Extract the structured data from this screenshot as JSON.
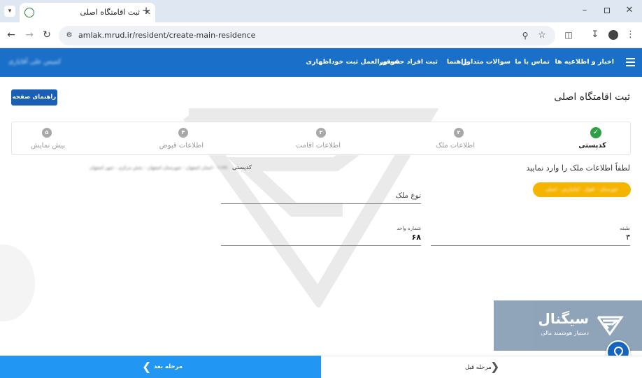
{
  "browser": {
    "tab_title": "ثبت اقامتگاه اصلی",
    "url": "amlak.mrud.ir/resident/create-main-residence"
  },
  "header": {
    "nav": [
      "اخبار و اطلاعیه ها",
      "تماس با ما",
      "سوالات متداول",
      "راهنما",
      "ثبت افراد حقوقی",
      "دستورالعمل ثبت خوداظهاری"
    ],
    "user_name": "کمیس علی آقایاری"
  },
  "page": {
    "title": "ثبت اقامتگاه اصلی",
    "guide_button": "راهنمای صفحه"
  },
  "stepper": {
    "steps": [
      {
        "number": "✓",
        "label": "کدپستی",
        "done": true
      },
      {
        "number": "۲",
        "label": "اطلاعات ملک",
        "done": false
      },
      {
        "number": "۳",
        "label": "اطلاعات اقامت",
        "done": false
      },
      {
        "number": "۴",
        "label": "اطلاعات قبوض",
        "done": false
      },
      {
        "number": "۵",
        "label": "پیش نمایش",
        "done": false
      }
    ]
  },
  "postal": {
    "label": "کدپستی",
    "address_blurred": "۱۱۹۹۰ - استان اصفهان - شهرستان اصفهان - بخش مرکزی - شهر اصفهان"
  },
  "form": {
    "instruction": "لطفاً اطلاعات ملک را وارد نمایید",
    "location_badge": "خوزستان - اهواز - کیانپارس - اصلی",
    "property_type_label": "نوع ملک",
    "floor_label": "طبقه",
    "floor_value": "۳",
    "unit_label": "شماره واحد",
    "unit_value": "۶۸"
  },
  "footer": {
    "next_label": "مرحله بعد",
    "prev_label": "مرحله قبل"
  },
  "watermark": {
    "brand": "سیگنال",
    "tagline": "دستیار هوشمند مالی"
  },
  "colors": {
    "primary": "#1a6fc9",
    "next_button": "#2196f3",
    "done_green": "#2ea043",
    "badge_yellow": "#f5b400"
  }
}
